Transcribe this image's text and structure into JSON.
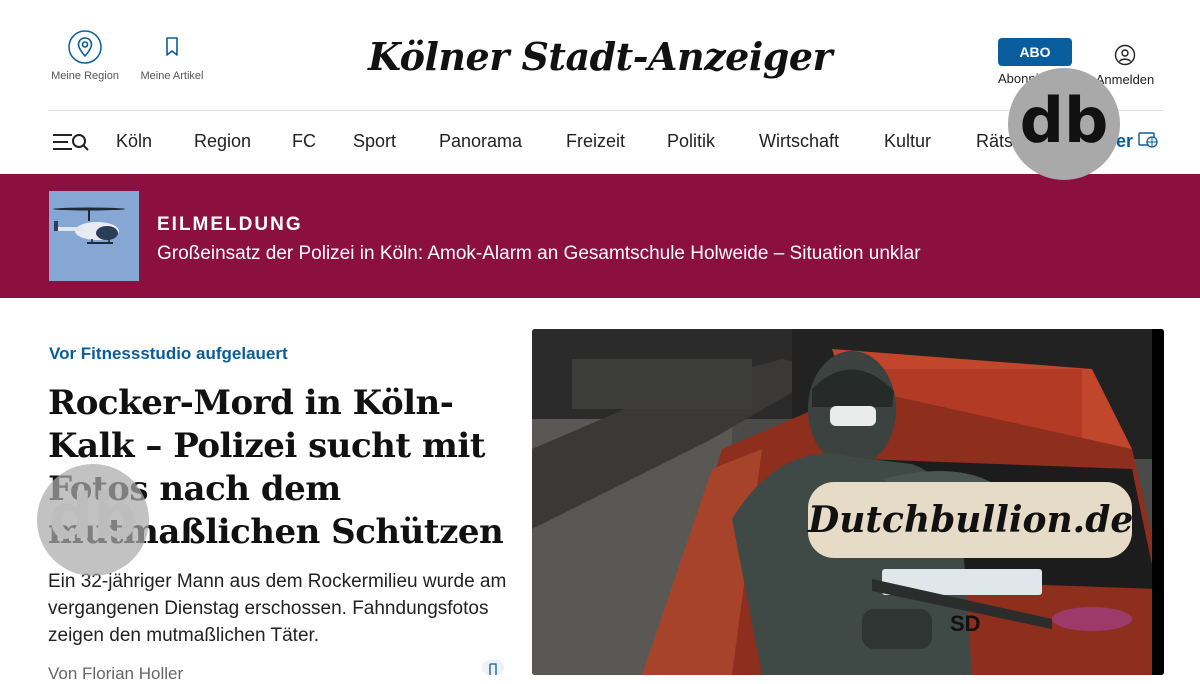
{
  "header": {
    "region_label": "Meine Region",
    "articles_label": "Meine Artikel",
    "logo_text": "Kölner Stadt-Anzeiger",
    "abo_button": "ABO",
    "abo_label": "Abonnieren",
    "login_label": "Anmelden"
  },
  "nav": {
    "items": [
      {
        "label": "Köln"
      },
      {
        "label": "Region"
      },
      {
        "label": "FC"
      },
      {
        "label": "Sport"
      },
      {
        "label": "Panorama"
      },
      {
        "label": "Freizeit"
      },
      {
        "label": "Politik"
      },
      {
        "label": "Wirtschaft"
      },
      {
        "label": "Kultur"
      },
      {
        "label": "Rätsel"
      }
    ],
    "more_label": "er"
  },
  "breaking": {
    "tag": "EILMELDUNG",
    "text": "Großeinsatz der Polizei in Köln: Amok-Alarm an Gesamtschule Holweide – Situation unklar"
  },
  "article": {
    "kicker": "Vor Fitnessstudio aufgelauert",
    "headline": "Rocker-Mord in Köln-Kalk – Polizei sucht mit Fotos nach dem mutmaßlichen Schützen",
    "teaser": "Ein 32-jähriger Mann aus dem Rockermilieu wurde am vergangenen Dienstag erschossen. Fahndungsfotos zeigen den mutmaßlichen Täter.",
    "byline": "Von Florian Holler"
  },
  "hero": {
    "plate_text": "SD"
  },
  "overlay": {
    "badge_text": "db",
    "watermark_text": "Dutchbullion.de"
  },
  "colors": {
    "accent_blue": "#0a5d9c",
    "breaking_bg": "#8b1040",
    "watermark_bg": "#e5dbc6"
  }
}
